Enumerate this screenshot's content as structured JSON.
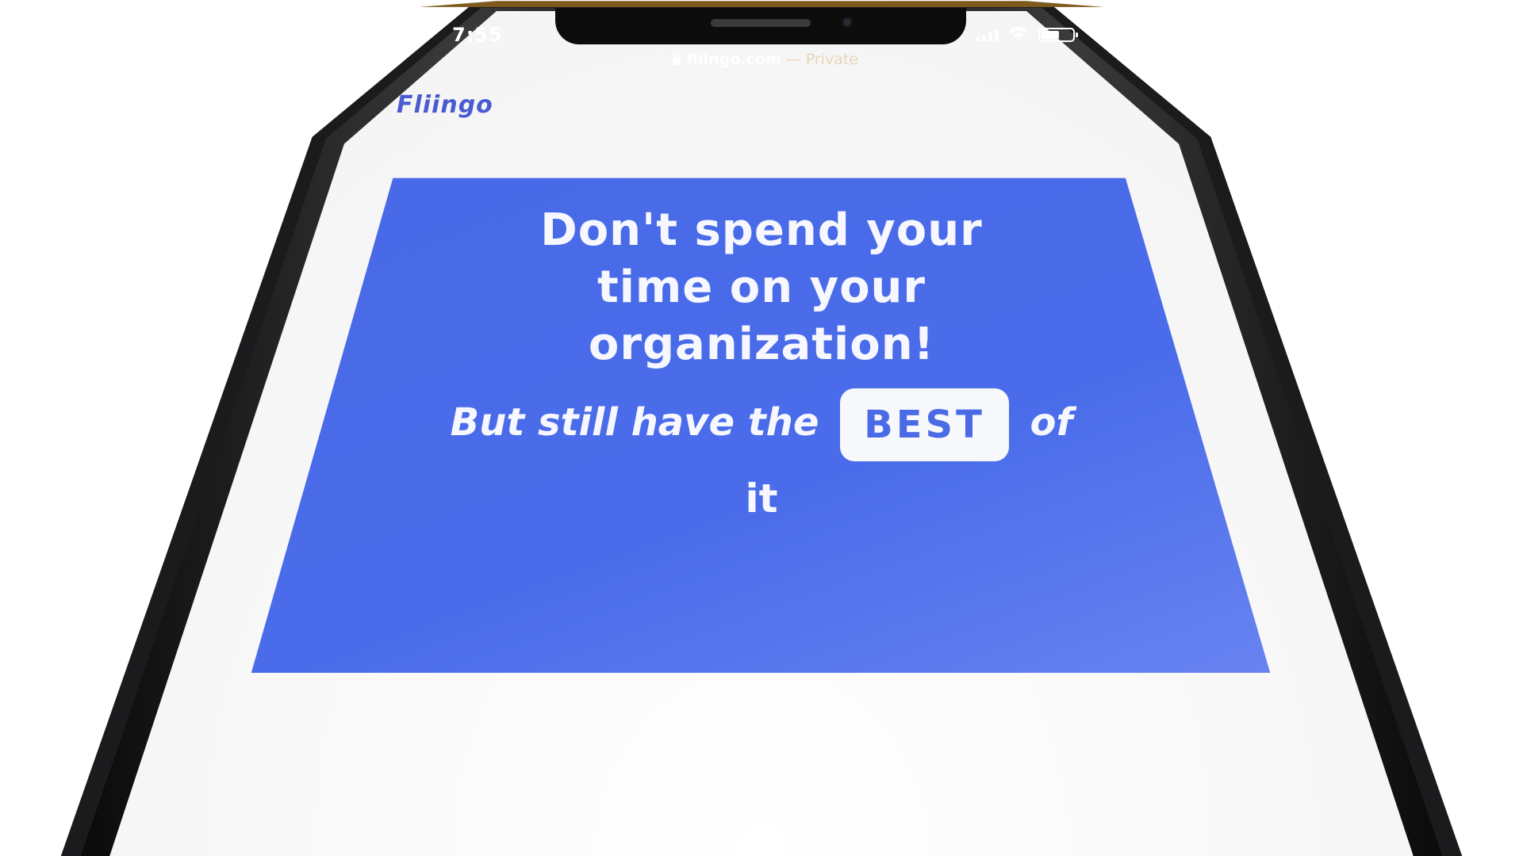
{
  "status_bar": {
    "time": "7:55",
    "battery_level": 0.6
  },
  "browser": {
    "host": "fliingo.com",
    "mode": "— Private"
  },
  "site": {
    "brand": "Fliingo"
  },
  "hero": {
    "headline_line1": "Don't spend your",
    "headline_line2": "time on your",
    "headline_line3": "organization!",
    "sub_before": "But still have the",
    "badge": "BEST",
    "sub_after": "of",
    "sub_tail": "it"
  },
  "colors": {
    "topbar": "#7e5a1e",
    "card_blue": "#4869e6",
    "brand_text": "#4a5bd1"
  },
  "icons": [
    "signal-icon",
    "wifi-icon",
    "battery-icon",
    "lock-icon"
  ]
}
